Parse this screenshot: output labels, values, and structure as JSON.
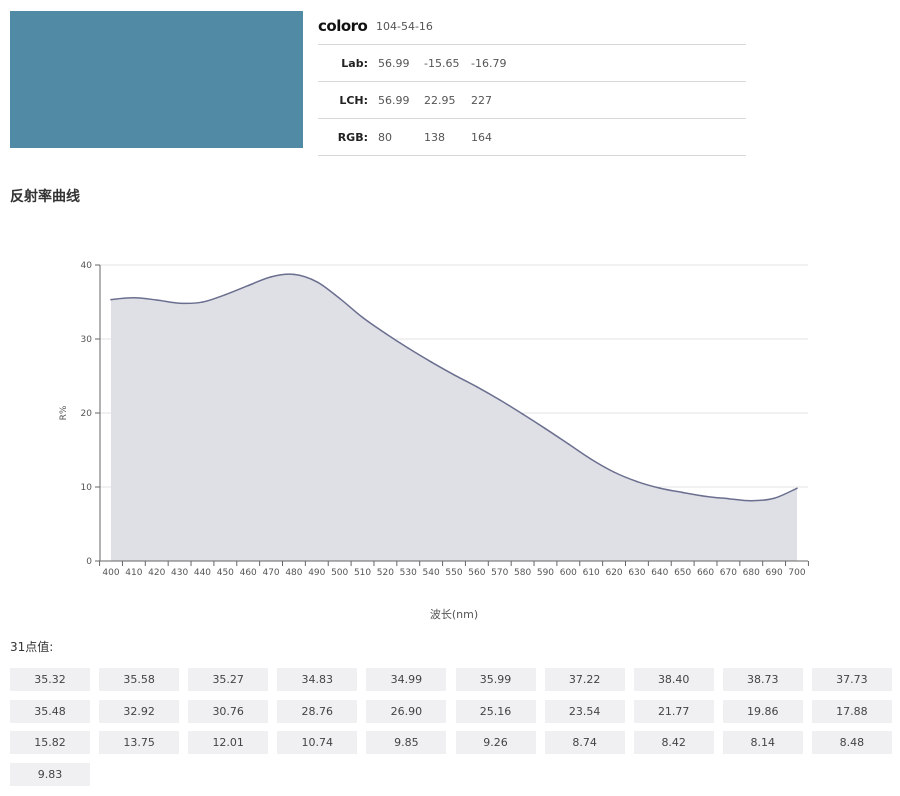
{
  "swatch": {
    "color": "#508aa4"
  },
  "info": {
    "brand": "coloro",
    "code": "104-54-16",
    "rows": [
      {
        "label": "Lab:",
        "values": [
          "56.99",
          "-15.65",
          "-16.79"
        ]
      },
      {
        "label": "LCH:",
        "values": [
          "56.99",
          "22.95",
          "227"
        ]
      },
      {
        "label": "RGB:",
        "values": [
          "80",
          "138",
          "164"
        ]
      }
    ]
  },
  "section_title": "反射率曲线",
  "points_title": "31点值:",
  "chart_data": {
    "type": "area",
    "title": "",
    "xlabel": "波长(nm)",
    "ylabel": "R%",
    "ylim": [
      0,
      40
    ],
    "yticks": [
      0,
      10,
      20,
      30,
      40
    ],
    "x": [
      400,
      410,
      420,
      430,
      440,
      450,
      460,
      470,
      480,
      490,
      500,
      510,
      520,
      530,
      540,
      550,
      560,
      570,
      580,
      590,
      600,
      610,
      620,
      630,
      640,
      650,
      660,
      670,
      680,
      690,
      700
    ],
    "series": [
      {
        "values": [
          35.32,
          35.58,
          35.27,
          34.83,
          34.99,
          35.99,
          37.22,
          38.4,
          38.73,
          37.73,
          35.48,
          32.92,
          30.76,
          28.76,
          26.9,
          25.16,
          23.54,
          21.77,
          19.86,
          17.88,
          15.82,
          13.75,
          12.01,
          10.74,
          9.85,
          9.26,
          8.74,
          8.42,
          8.14,
          8.48,
          9.83
        ]
      }
    ],
    "grid": true,
    "colors": {
      "line": "#6b6f8f",
      "fill": "#dfe0e6",
      "grid": "#e3e3e3"
    }
  },
  "points": [
    "35.32",
    "35.58",
    "35.27",
    "34.83",
    "34.99",
    "35.99",
    "37.22",
    "38.40",
    "38.73",
    "37.73",
    "35.48",
    "32.92",
    "30.76",
    "28.76",
    "26.90",
    "25.16",
    "23.54",
    "21.77",
    "19.86",
    "17.88",
    "15.82",
    "13.75",
    "12.01",
    "10.74",
    "9.85",
    "9.26",
    "8.74",
    "8.42",
    "8.14",
    "8.48",
    "9.83"
  ]
}
